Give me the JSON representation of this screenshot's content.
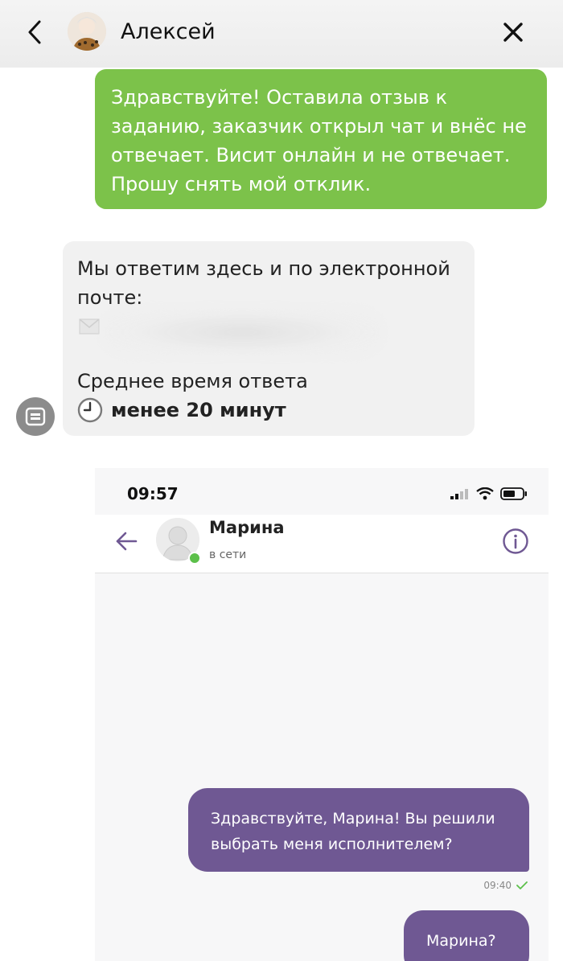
{
  "header": {
    "title": "Алексей",
    "back_icon": "chevron-left-icon",
    "close_icon": "close-icon"
  },
  "messages": {
    "outgoing": {
      "text": "Здравствуйте! Оставила отзыв к заданию, заказчик открыл чат и внёс не отвечает. Висит онлайн и не отвечает. Прошу снять мой отклик.",
      "color": "#7cc24a"
    },
    "incoming": {
      "intro": "Мы ответим здесь и по электронной почте:",
      "avg_label": "Среднее время ответа",
      "avg_value": "менее 20 минут",
      "clock_icon": "clock-icon"
    }
  },
  "screenshot": {
    "status_time": "09:57",
    "contact_name": "Марина",
    "contact_status": "в сети",
    "accent": "#6f5893",
    "bubble_one": "Здравствуйте, Марина! Вы решили выбрать меня исполнителем?",
    "bubble_one_time": "09:40",
    "bubble_two": "Марина?"
  }
}
